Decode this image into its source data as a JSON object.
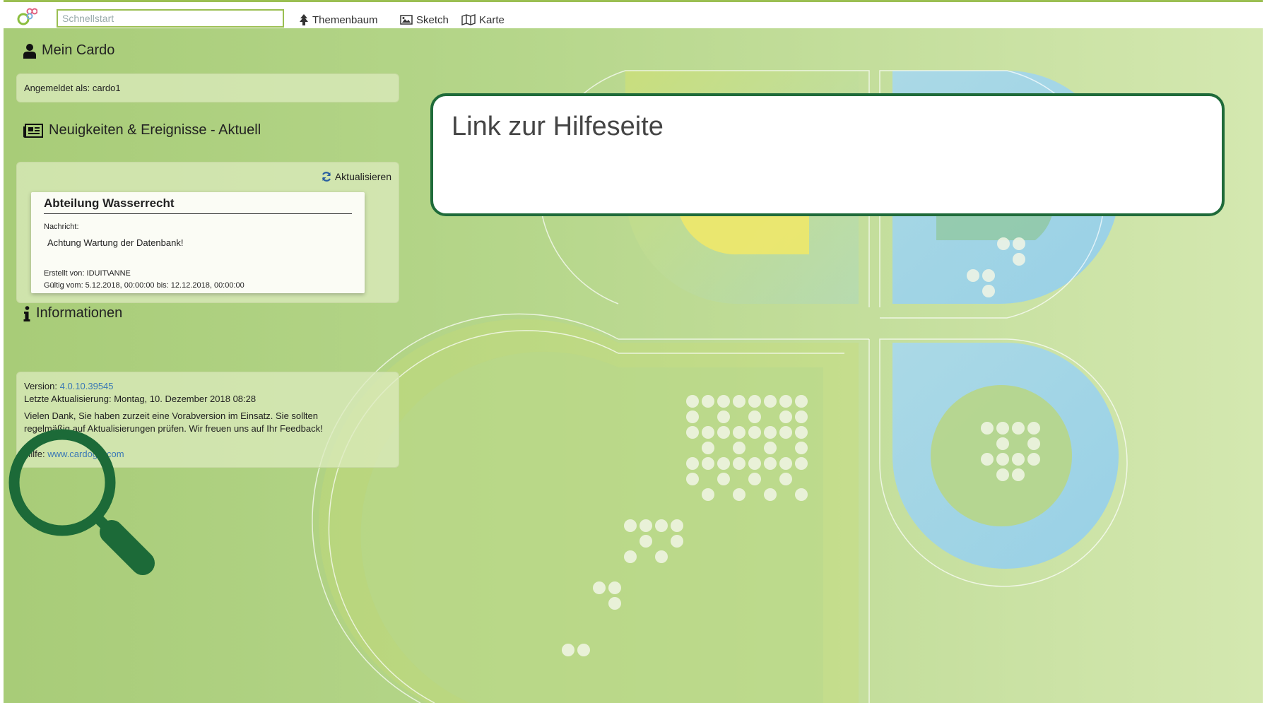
{
  "topbar": {
    "logo_icon": "cardo-logo-icon",
    "search_placeholder": "Schnellstart",
    "nav": [
      {
        "label": "Themenbaum",
        "icon": "tree-icon"
      },
      {
        "label": "Sketch",
        "icon": "image-icon"
      },
      {
        "label": "Karte",
        "icon": "map-icon"
      }
    ]
  },
  "mein_cardo": {
    "title": "Mein Cardo",
    "icon": "user-icon",
    "logged_in": "Angemeldet als: cardo1"
  },
  "news": {
    "title": "Neuigkeiten & Ereignisse - Aktuell",
    "icon": "newspaper-icon",
    "refresh_label": "Aktualisieren",
    "refresh_icon": "refresh-icon",
    "card": {
      "heading": "Abteilung Wasserrecht",
      "message_label": "Nachricht:",
      "message": "Achtung Wartung der Datenbank!",
      "author": "Erstellt von: IDUIT\\ANNE",
      "validity": "Gültig vom: 5.12.2018, 00:00:00 bis: 12.12.2018, 00:00:00"
    }
  },
  "info": {
    "title": "Informationen",
    "icon": "info-icon",
    "version_label": "Version:",
    "version": "4.0.10.39545",
    "last_update": "Letzte Aktualisierung: Montag, 10. Dezember 2018 08:28",
    "notice_line1": "Vielen Dank, Sie haben zurzeit eine Vorabversion im Einsatz. Sie sollten",
    "notice_line2": "regelmäßig auf Aktualisierungen prüfen. Wir freuen uns auf Ihr Feedback!",
    "help_label": "Hilfe:",
    "help_link": "www.cardogis.com"
  },
  "callout": {
    "text": "Link zur Hilfeseite"
  },
  "overlay": {
    "icon": "magnifier-icon"
  },
  "colors": {
    "accent": "#9bbf52",
    "callout_border": "#1f6b3a",
    "link": "#3a78b5"
  }
}
